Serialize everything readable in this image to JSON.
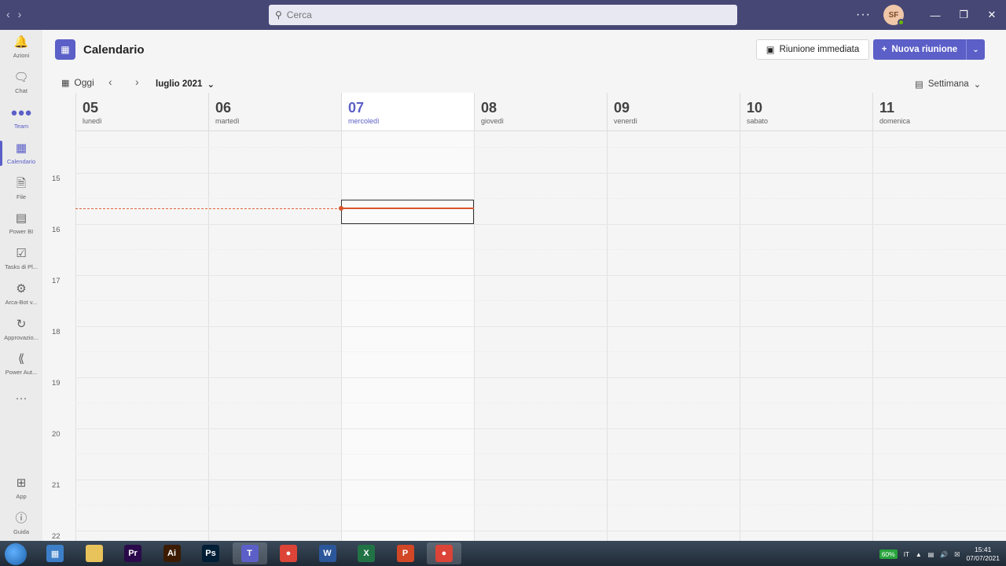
{
  "titlebar": {
    "search_placeholder": "Cerca",
    "more": "···",
    "avatar_initials": "SF",
    "minimize": "—",
    "maximize": "❐",
    "close": "✕"
  },
  "rail": {
    "items": [
      {
        "label": "Azioni",
        "icon": "bell-icon"
      },
      {
        "label": "Chat",
        "icon": "chat-icon"
      },
      {
        "label": "Team",
        "icon": "teams-icon"
      },
      {
        "label": "Calendario",
        "icon": "calendar-icon"
      },
      {
        "label": "File",
        "icon": "file-icon"
      },
      {
        "label": "Power BI",
        "icon": "powerbi-icon"
      },
      {
        "label": "Tasks di Pl...",
        "icon": "tasks-icon"
      },
      {
        "label": "Arca-Bot v...",
        "icon": "bot-icon"
      },
      {
        "label": "Approvazio...",
        "icon": "approvals-icon"
      },
      {
        "label": "Power Aut...",
        "icon": "power-automate-icon"
      }
    ],
    "more": "···",
    "apps_label": "App",
    "help_label": "Guida"
  },
  "header": {
    "title": "Calendario",
    "immediate_label": "Riunione immediata",
    "new_meeting_label": "Nuova riunione"
  },
  "toolbar": {
    "today_label": "Oggi",
    "month_label": "luglio 2021",
    "view_label": "Settimana"
  },
  "days": [
    {
      "num": "05",
      "name": "lunedì"
    },
    {
      "num": "06",
      "name": "martedì"
    },
    {
      "num": "07",
      "name": "mercoledì"
    },
    {
      "num": "08",
      "name": "giovedì"
    },
    {
      "num": "09",
      "name": "venerdì"
    },
    {
      "num": "10",
      "name": "sabato"
    },
    {
      "num": "11",
      "name": "domenica"
    }
  ],
  "hours": [
    "15",
    "16",
    "17",
    "18",
    "19",
    "20",
    "21",
    "22"
  ],
  "taskbar": {
    "apps": [
      {
        "name": "screen-app",
        "letter": "▦",
        "color": "#3c7fc8"
      },
      {
        "name": "file-explorer",
        "letter": "",
        "color": "#e8c25a"
      },
      {
        "name": "premiere",
        "letter": "Pr",
        "color": "#2a0a4a"
      },
      {
        "name": "illustrator",
        "letter": "Ai",
        "color": "#3b1c00"
      },
      {
        "name": "photoshop",
        "letter": "Ps",
        "color": "#001e36"
      },
      {
        "name": "teams",
        "letter": "T",
        "color": "#5b5fc7"
      },
      {
        "name": "chrome",
        "letter": "●",
        "color": "#db4437"
      },
      {
        "name": "word",
        "letter": "W",
        "color": "#2b579a"
      },
      {
        "name": "excel",
        "letter": "X",
        "color": "#217346"
      },
      {
        "name": "powerpoint",
        "letter": "P",
        "color": "#d24726"
      },
      {
        "name": "chrome-2",
        "letter": "●",
        "color": "#db4437"
      }
    ],
    "battery": "60%",
    "language": "IT",
    "time": "15:41",
    "date": "07/07/2021"
  }
}
